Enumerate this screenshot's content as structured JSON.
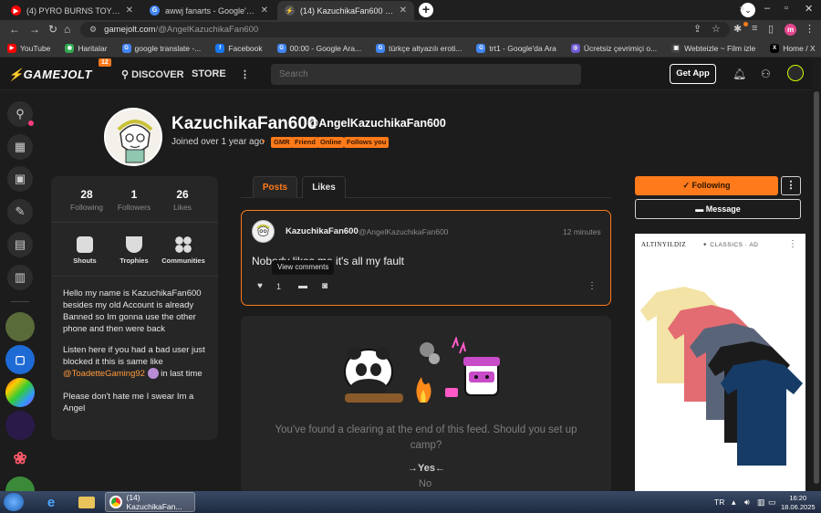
{
  "browser": {
    "tabs": [
      {
        "title": "(4) PYRO BURNS TOY FREDDY || ...",
        "favicon_color": "#ff0000",
        "favicon_glyph": "▶"
      },
      {
        "title": "awwj fanarts - Google'da Ara",
        "favicon_color": "#4285f4",
        "favicon_glyph": "G"
      },
      {
        "title": "(14) KazuchikaFan600 (@AngelK...",
        "favicon_color": "#555555",
        "favicon_glyph": "⚡"
      }
    ],
    "new_tab_glyph": "+",
    "close_glyph": "✕",
    "url_host": "gamejolt.com",
    "url_path": "/@AngelKazuchikaFan600",
    "profile_initial": "m",
    "bookmarks": [
      {
        "label": "YouTube",
        "color": "#ff0000",
        "glyph": "▶"
      },
      {
        "label": "Haritalar",
        "color": "#34a853",
        "glyph": "◉"
      },
      {
        "label": "google translate -...",
        "color": "#4285f4",
        "glyph": "G"
      },
      {
        "label": "Facebook",
        "color": "#1877f2",
        "glyph": "f"
      },
      {
        "label": "00:00 - Google Ara...",
        "color": "#4285f4",
        "glyph": "G"
      },
      {
        "label": "türkçe altyazılı eroti...",
        "color": "#4285f4",
        "glyph": "G"
      },
      {
        "label": "trt1 - Google'da Ara",
        "color": "#4285f4",
        "glyph": "G"
      },
      {
        "label": "Ücretsiz çevrimiçi o...",
        "color": "#6b5bd2",
        "glyph": "◎"
      },
      {
        "label": "Webteizle ~ Film izle",
        "color": "#444444",
        "glyph": "▣"
      },
      {
        "label": "Home / X",
        "color": "#000000",
        "glyph": "X"
      }
    ],
    "bookmarks_more": "»"
  },
  "gj": {
    "logo": "⚡GAMEJOLT",
    "logo_badge": "12",
    "nav": {
      "discover": "DISCOVER",
      "store": "STORE",
      "more": "⋮"
    },
    "search_placeholder": "Search",
    "get_app": "Get App",
    "accent": "#ff7a1a"
  },
  "profile": {
    "name": "KazuchikaFan600",
    "handle": "@AngelKazuchikaFan600",
    "joined": "Joined over 1 year ago",
    "joined_dot": "•",
    "tags": [
      "GMR",
      "Friend",
      "Online",
      "Follows you"
    ],
    "stats": [
      {
        "num": "28",
        "label": "Following"
      },
      {
        "num": "1",
        "label": "Followers"
      },
      {
        "num": "26",
        "label": "Likes"
      }
    ],
    "quick": [
      "Shouts",
      "Trophies",
      "Communities"
    ],
    "bio1": "Hello my name is KazuchikaFan600 besides my old Account is already Banned so Im gonna use the other phone and then were back",
    "bio2_pre": "Listen here if you had a bad user just blocked it this is same like",
    "bio2_mention": "@ToadetteGaming92",
    "bio2_post": "in last time",
    "bio3": "Please don't hate me I swear Im a Angel"
  },
  "tabs": {
    "posts": "Posts",
    "likes": "Likes"
  },
  "post": {
    "user": "KazuchikaFan600",
    "handle": "@AngelKazuchikaFan600",
    "time": "12 minutes",
    "body": "Nobody likes me it's all my fault",
    "tooltip": "View comments",
    "like_count": "1",
    "menu": "⋮"
  },
  "feed_end": {
    "message": "You've found a clearing at the end of this feed. Should you set up camp?",
    "yes": "→Yes←",
    "no": "No"
  },
  "actions": {
    "following": "✓ Following",
    "more": "⋮",
    "message": "Message"
  },
  "ad": {
    "brand": "ALTINYILDIZ",
    "brand2": "✦ CLASSICS · AD",
    "menu": "⋮"
  },
  "taskbar": {
    "chrome_label": "(14) KazuchikaFan...",
    "lang": "TR",
    "time": "16:20",
    "date": "18.06.2025"
  }
}
